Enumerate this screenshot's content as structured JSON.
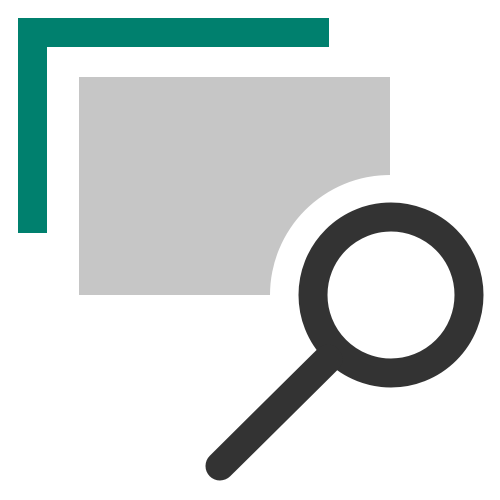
{
  "icon": {
    "name": "browse-pages-search-icon",
    "parts": {
      "back_page": "back-page-icon",
      "front_page": "front-page-icon",
      "magnifier": "magnifying-glass-icon"
    },
    "colors": {
      "background": "#ffffff",
      "back_page_outline": "#00806e",
      "front_page_fill": "#c6c6c6",
      "magnifier": "#333333"
    }
  }
}
